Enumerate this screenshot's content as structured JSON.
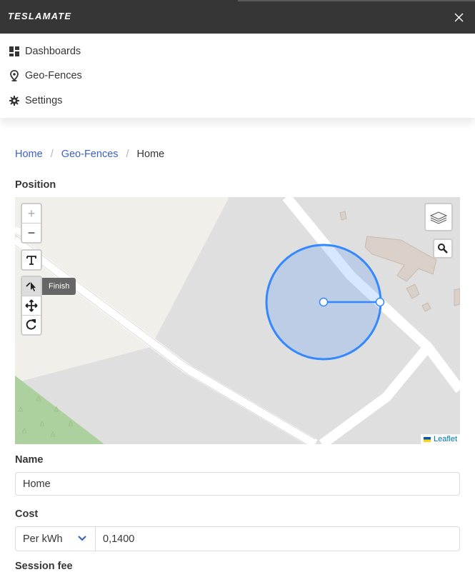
{
  "app": {
    "brand": "TESLAMATE"
  },
  "menu": {
    "items": [
      {
        "label": "Dashboards",
        "icon": "dashboard-icon"
      },
      {
        "label": "Geo-Fences",
        "icon": "map-marker-icon"
      },
      {
        "label": "Settings",
        "icon": "gear-icon"
      }
    ]
  },
  "breadcrumb": [
    "Home",
    "Geo-Fences",
    "Home"
  ],
  "form": {
    "position_label": "Position",
    "name_label": "Name",
    "name_value": "Home",
    "cost_label": "Cost",
    "cost_mode": "Per kWh",
    "cost_value": "0,1400",
    "session_fee_label": "Session fee"
  },
  "map": {
    "zoom_in": "+",
    "zoom_out": "−",
    "tooltip": "Finish",
    "attribution": "Leaflet",
    "circle_color": "#3388ff"
  },
  "colors": {
    "topbar": "#363636",
    "link": "#3e61c9"
  }
}
